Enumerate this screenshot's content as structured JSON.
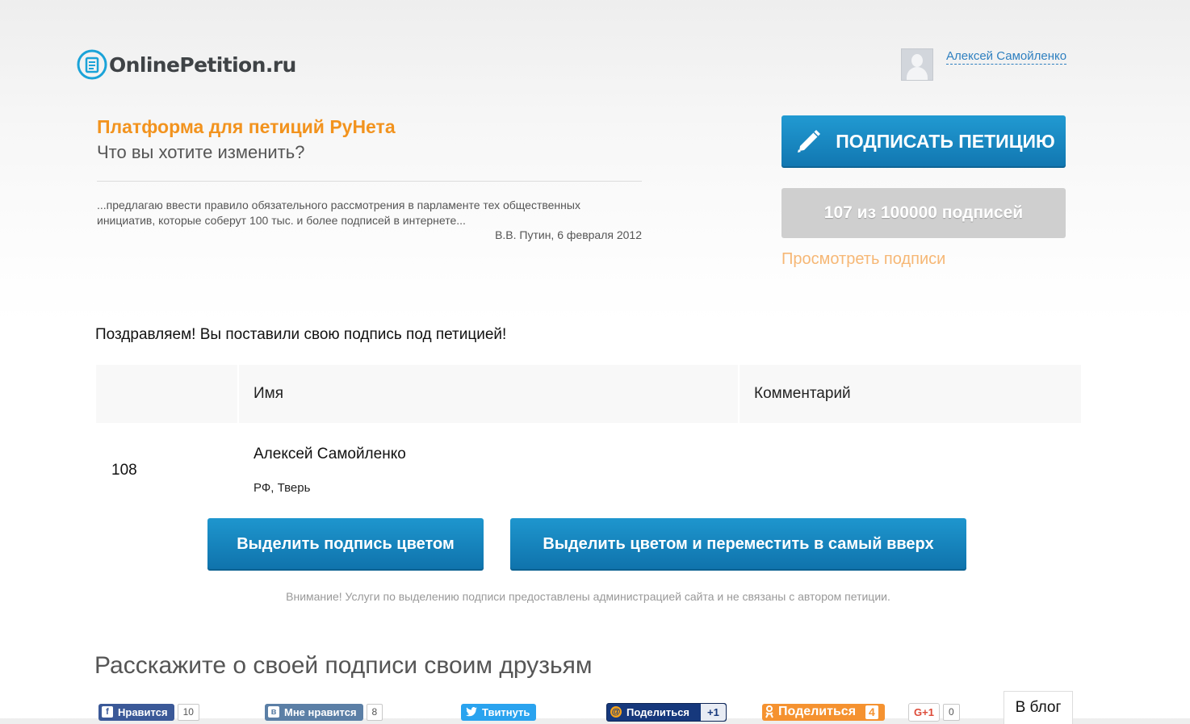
{
  "header": {
    "logo_text": "OnlinePetition.ru",
    "user_name": "Алексей Самойленко"
  },
  "intro": {
    "tagline": "Платформа для петиций РуНета",
    "subtagline": "Что вы хотите изменить?",
    "quote": "...предлагаю ввести правило обязательного рассмотрения в парламенте тех общественных инициатив, которые соберут 100 тыс. и более подписей в интернете...",
    "quote_author": "В.В. Путин, 6 февраля 2012"
  },
  "petition": {
    "sign_button": "ПОДПИСАТЬ ПЕТИЦИЮ",
    "counter_text": "107 из 100000 подписей",
    "view_signatures": "Просмотреть подписи"
  },
  "confirmation": {
    "message": "Поздравляем! Вы поставили свою подпись под петицией!"
  },
  "table": {
    "columns": [
      "",
      "Имя",
      "Комментарий"
    ],
    "rows": [
      {
        "number": "108",
        "name": "Алексей Самойленко",
        "location": "РФ, Тверь",
        "comment": ""
      }
    ]
  },
  "actions": {
    "highlight": "Выделить подпись цветом",
    "highlight_top": "Выделить цветом и переместить в самый вверх",
    "notice": "Внимание! Услуги по выделению подписи предоставлены администрацией сайта и не связаны с автором петиции."
  },
  "share": {
    "title": "Расскажите о своей подписи своим друзьям",
    "facebook": {
      "icon": "facebook-icon",
      "label": "Нравится",
      "count": "10"
    },
    "vkontakte": {
      "icon": "vk-icon",
      "label": "Мне нравится",
      "count": "8"
    },
    "twitter": {
      "icon": "twitter-bird-icon",
      "label": "Твитнуть"
    },
    "mailru": {
      "icon": "mailru-at-icon",
      "label": "Поделиться",
      "count": "+1"
    },
    "odnoklassniki": {
      "icon": "odnoklassniki-icon",
      "label": "Поделиться",
      "count": "4"
    },
    "googleplus": {
      "label": "G+1",
      "count": "0"
    },
    "blog": "В блог"
  },
  "colors": {
    "brand_orange": "#f2931e",
    "button_blue": "#1a88c2",
    "counter_gray": "#cfcfcf",
    "link_blue": "#2f80c0"
  }
}
